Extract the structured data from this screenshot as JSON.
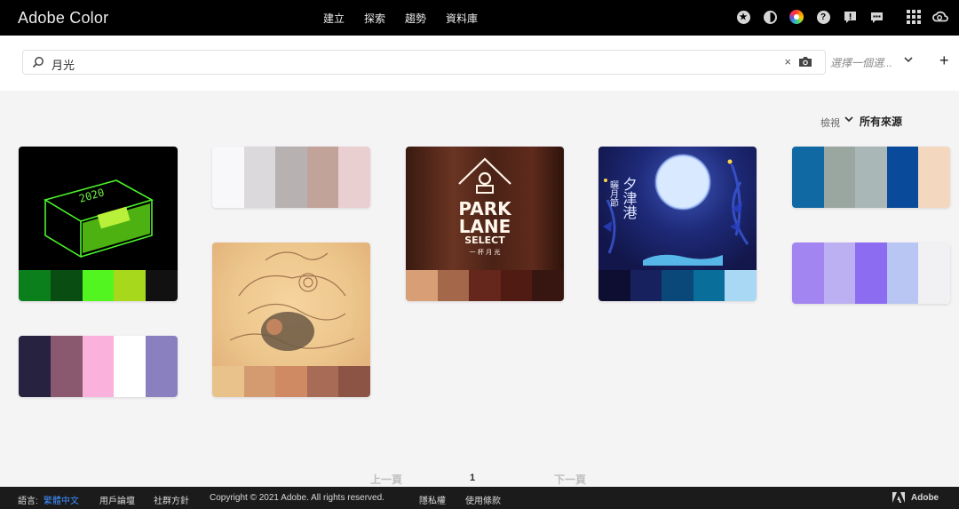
{
  "header": {
    "brand": "Adobe Color",
    "nav": [
      "建立",
      "探索",
      "趨勢",
      "資料庫"
    ],
    "icons": [
      "star-icon",
      "contrast-icon",
      "color-wheel-icon",
      "help-icon",
      "alert-icon",
      "chat-icon",
      "apps-grid-icon",
      "creative-cloud-icon"
    ]
  },
  "search": {
    "value": "月光",
    "clear_label": "×",
    "select_placeholder": "選擇一個選...",
    "plus_label": "+"
  },
  "sort": {
    "label": "檢視",
    "value": "所有來源"
  },
  "themes": {
    "t1": {
      "swatches": [
        "#0b7f1b",
        "#0a4d12",
        "#52f520",
        "#a7d81b",
        "#111111"
      ]
    },
    "t2": {
      "swatches": [
        "#f8f7f9",
        "#dcd9dc",
        "#b7b1b1",
        "#c2a39a",
        "#eacfd1"
      ]
    },
    "t3": {
      "swatches": [
        "#d89f76",
        "#a5674a",
        "#65261b",
        "#4f1b12",
        "#371510"
      ],
      "sign_lines": [
        "PARK",
        "LANE",
        "SELECT",
        "一 杯 月 光"
      ]
    },
    "t4": {
      "swatches": [
        "#0e0d32",
        "#16215e",
        "#0a4879",
        "#096f9a",
        "#a9d8f4"
      ],
      "poster_text": [
        "夕津港",
        "曬月節"
      ]
    },
    "t5": {
      "swatches": [
        "#1169a4",
        "#9aa7a1",
        "#a9b8b7",
        "#0a4a9a",
        "#f4d7bf"
      ]
    },
    "t6": {
      "swatches": [
        "#e9c18b",
        "#d49b70",
        "#cf8a63",
        "#a86b56",
        "#8c5444"
      ]
    },
    "t7": {
      "swatches": [
        "#27223f",
        "#8a596f",
        "#fab1db",
        "#ffffff",
        "#8a80c0"
      ]
    },
    "t8": {
      "swatches": [
        "#a285f0",
        "#bcb0f3",
        "#8c6cf0",
        "#b9c5f2",
        "#f1f0f2"
      ]
    }
  },
  "pagination": {
    "prev": "上一頁",
    "page": "1",
    "next": "下一頁"
  },
  "footer": {
    "lang_label": "語言:",
    "lang_value": "繁體中文",
    "forum": "用戶論壇",
    "guidelines": "社群方針",
    "copyright": "Copyright © 2021 Adobe. All rights reserved.",
    "privacy": "隱私權",
    "terms": "使用條款",
    "adobe": "Adobe"
  }
}
